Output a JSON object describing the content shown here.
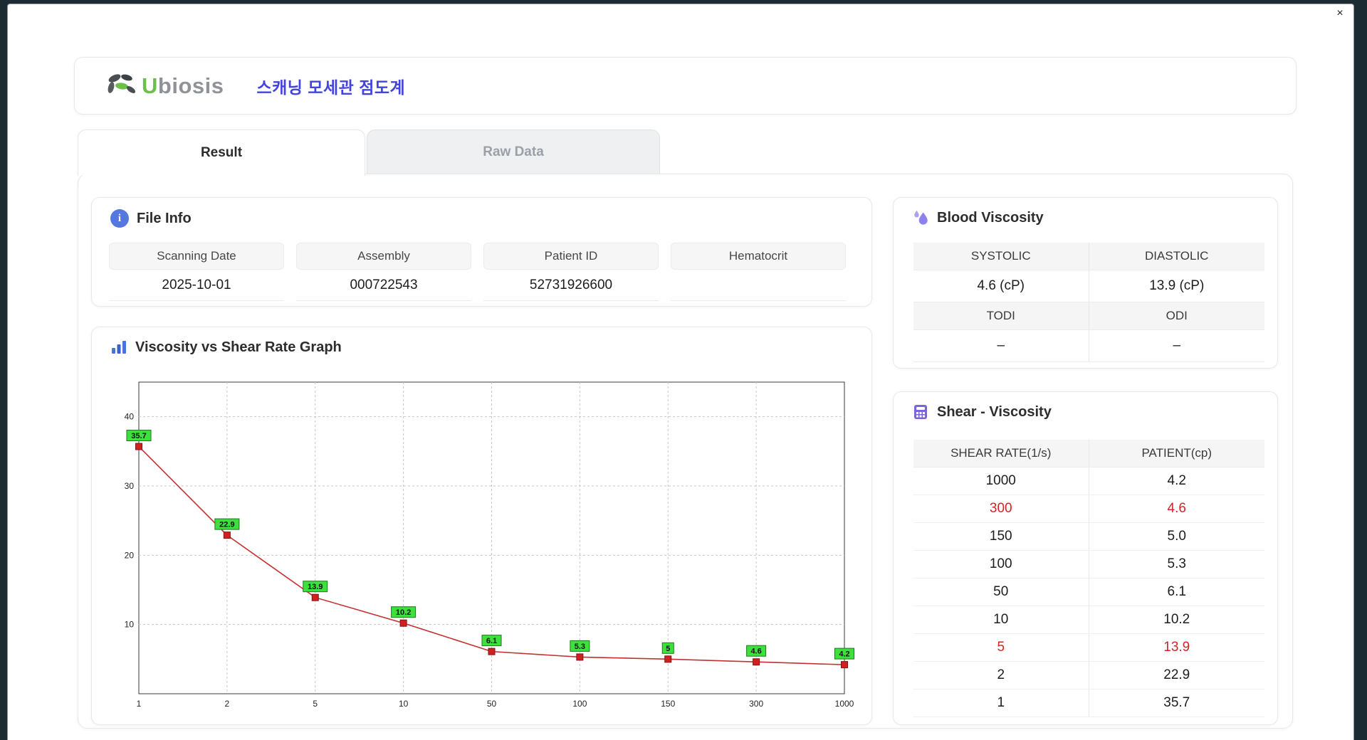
{
  "window": {
    "close_icon": "×"
  },
  "header": {
    "logo_first": "U",
    "logo_rest": "biosis",
    "title": "스캐닝 모세관 점도계"
  },
  "tabs": [
    {
      "label": "Result",
      "active": true
    },
    {
      "label": "Raw Data",
      "active": false
    }
  ],
  "file_info": {
    "title": "File Info",
    "fields": [
      {
        "label": "Scanning Date",
        "value": "2025-10-01"
      },
      {
        "label": "Assembly",
        "value": "000722543"
      },
      {
        "label": "Patient ID",
        "value": "52731926600"
      },
      {
        "label": "Hematocrit",
        "value": ""
      }
    ]
  },
  "blood_viscosity": {
    "title": "Blood Viscosity",
    "col1_header": "SYSTOLIC",
    "col2_header": "DIASTOLIC",
    "col1_value": "4.6 (cP)",
    "col2_value": "13.9 (cP)",
    "col3_header": "TODI",
    "col4_header": "ODI",
    "col3_value": "–",
    "col4_value": "–"
  },
  "graph": {
    "title": "Viscosity vs Shear Rate Graph"
  },
  "chart_data": {
    "type": "line",
    "title": "Viscosity vs Shear Rate Graph",
    "x": [
      1,
      2,
      5,
      10,
      50,
      100,
      150,
      300,
      1000
    ],
    "values": [
      35.7,
      22.9,
      13.9,
      10.2,
      6.1,
      5.3,
      5.0,
      4.6,
      4.2
    ],
    "point_labels": [
      "35.7",
      "22.9",
      "13.9",
      "10.2",
      "6.1",
      "5.3",
      "5",
      "4.6",
      "4.2"
    ],
    "xlabel": "",
    "ylabel": "",
    "yticks": [
      10,
      20,
      30,
      40
    ],
    "ylim": [
      0,
      45
    ],
    "grid": true,
    "line_color": "#c53030",
    "marker_color": "#d02020",
    "marker_edge": "#8a1010",
    "label_bg": "#3de03d",
    "label_edge": "#1a7a1a"
  },
  "shear_table": {
    "title": "Shear - Viscosity",
    "columns": [
      "SHEAR RATE(1/s)",
      "PATIENT(cp)"
    ],
    "rows": [
      {
        "shear": "1000",
        "patient": "4.2",
        "highlight": false
      },
      {
        "shear": "300",
        "patient": "4.6",
        "highlight": true
      },
      {
        "shear": "150",
        "patient": "5.0",
        "highlight": false
      },
      {
        "shear": "100",
        "patient": "5.3",
        "highlight": false
      },
      {
        "shear": "50",
        "patient": "6.1",
        "highlight": false
      },
      {
        "shear": "10",
        "patient": "10.2",
        "highlight": false
      },
      {
        "shear": "5",
        "patient": "13.9",
        "highlight": true
      },
      {
        "shear": "2",
        "patient": "22.9",
        "highlight": false
      },
      {
        "shear": "1",
        "patient": "35.7",
        "highlight": false
      }
    ]
  },
  "colors": {
    "accent_blue": "#4343e0",
    "logo_green": "#6cc04a",
    "highlight_red": "#d02525"
  }
}
